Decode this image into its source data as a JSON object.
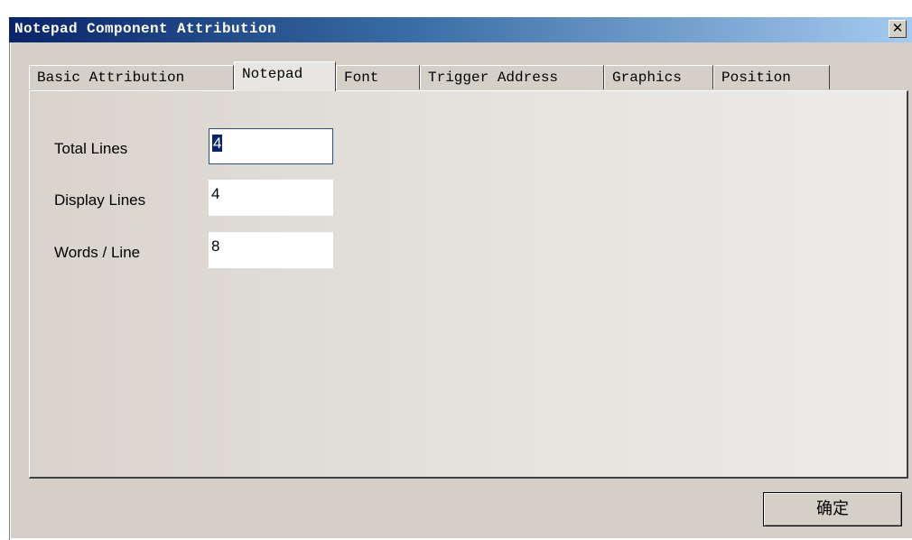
{
  "window": {
    "title": "Notepad Component Attribution",
    "close_label": "✕"
  },
  "tabs": [
    {
      "label": "Basic Attribution",
      "active": false
    },
    {
      "label": "Notepad",
      "active": true
    },
    {
      "label": "Font",
      "active": false
    },
    {
      "label": "Trigger Address",
      "active": false
    },
    {
      "label": "Graphics",
      "active": false
    },
    {
      "label": "Position",
      "active": false
    }
  ],
  "fields": {
    "total_lines": {
      "label": "Total Lines",
      "value": "4"
    },
    "display_lines": {
      "label": "Display Lines",
      "value": "4"
    },
    "words_per_line": {
      "label": "Words / Line",
      "value": "8"
    }
  },
  "buttons": {
    "ok_label": "确定"
  },
  "colors": {
    "title_bar_start": "#0a246a",
    "title_bar_end": "#a6caf0",
    "face": "#d4d0c8",
    "selection": "#0a246a"
  }
}
